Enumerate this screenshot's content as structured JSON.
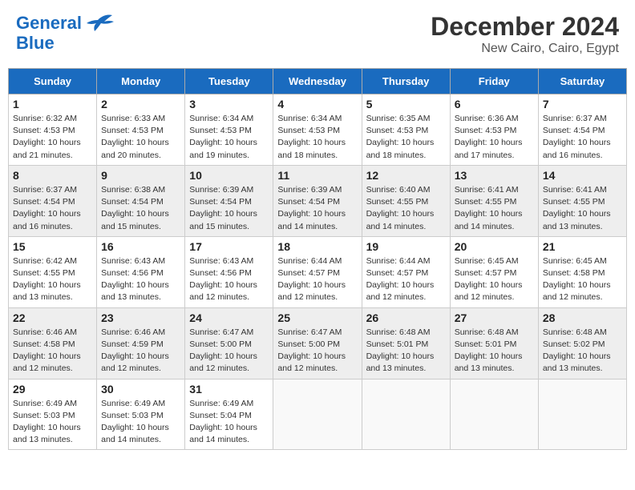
{
  "header": {
    "logo_line1": "General",
    "logo_line2": "Blue",
    "month": "December 2024",
    "location": "New Cairo, Cairo, Egypt"
  },
  "days_of_week": [
    "Sunday",
    "Monday",
    "Tuesday",
    "Wednesday",
    "Thursday",
    "Friday",
    "Saturday"
  ],
  "weeks": [
    [
      {
        "day": "1",
        "info": "Sunrise: 6:32 AM\nSunset: 4:53 PM\nDaylight: 10 hours\nand 21 minutes."
      },
      {
        "day": "2",
        "info": "Sunrise: 6:33 AM\nSunset: 4:53 PM\nDaylight: 10 hours\nand 20 minutes."
      },
      {
        "day": "3",
        "info": "Sunrise: 6:34 AM\nSunset: 4:53 PM\nDaylight: 10 hours\nand 19 minutes."
      },
      {
        "day": "4",
        "info": "Sunrise: 6:34 AM\nSunset: 4:53 PM\nDaylight: 10 hours\nand 18 minutes."
      },
      {
        "day": "5",
        "info": "Sunrise: 6:35 AM\nSunset: 4:53 PM\nDaylight: 10 hours\nand 18 minutes."
      },
      {
        "day": "6",
        "info": "Sunrise: 6:36 AM\nSunset: 4:53 PM\nDaylight: 10 hours\nand 17 minutes."
      },
      {
        "day": "7",
        "info": "Sunrise: 6:37 AM\nSunset: 4:54 PM\nDaylight: 10 hours\nand 16 minutes."
      }
    ],
    [
      {
        "day": "8",
        "info": "Sunrise: 6:37 AM\nSunset: 4:54 PM\nDaylight: 10 hours\nand 16 minutes."
      },
      {
        "day": "9",
        "info": "Sunrise: 6:38 AM\nSunset: 4:54 PM\nDaylight: 10 hours\nand 15 minutes."
      },
      {
        "day": "10",
        "info": "Sunrise: 6:39 AM\nSunset: 4:54 PM\nDaylight: 10 hours\nand 15 minutes."
      },
      {
        "day": "11",
        "info": "Sunrise: 6:39 AM\nSunset: 4:54 PM\nDaylight: 10 hours\nand 14 minutes."
      },
      {
        "day": "12",
        "info": "Sunrise: 6:40 AM\nSunset: 4:55 PM\nDaylight: 10 hours\nand 14 minutes."
      },
      {
        "day": "13",
        "info": "Sunrise: 6:41 AM\nSunset: 4:55 PM\nDaylight: 10 hours\nand 14 minutes."
      },
      {
        "day": "14",
        "info": "Sunrise: 6:41 AM\nSunset: 4:55 PM\nDaylight: 10 hours\nand 13 minutes."
      }
    ],
    [
      {
        "day": "15",
        "info": "Sunrise: 6:42 AM\nSunset: 4:55 PM\nDaylight: 10 hours\nand 13 minutes."
      },
      {
        "day": "16",
        "info": "Sunrise: 6:43 AM\nSunset: 4:56 PM\nDaylight: 10 hours\nand 13 minutes."
      },
      {
        "day": "17",
        "info": "Sunrise: 6:43 AM\nSunset: 4:56 PM\nDaylight: 10 hours\nand 12 minutes."
      },
      {
        "day": "18",
        "info": "Sunrise: 6:44 AM\nSunset: 4:57 PM\nDaylight: 10 hours\nand 12 minutes."
      },
      {
        "day": "19",
        "info": "Sunrise: 6:44 AM\nSunset: 4:57 PM\nDaylight: 10 hours\nand 12 minutes."
      },
      {
        "day": "20",
        "info": "Sunrise: 6:45 AM\nSunset: 4:57 PM\nDaylight: 10 hours\nand 12 minutes."
      },
      {
        "day": "21",
        "info": "Sunrise: 6:45 AM\nSunset: 4:58 PM\nDaylight: 10 hours\nand 12 minutes."
      }
    ],
    [
      {
        "day": "22",
        "info": "Sunrise: 6:46 AM\nSunset: 4:58 PM\nDaylight: 10 hours\nand 12 minutes."
      },
      {
        "day": "23",
        "info": "Sunrise: 6:46 AM\nSunset: 4:59 PM\nDaylight: 10 hours\nand 12 minutes."
      },
      {
        "day": "24",
        "info": "Sunrise: 6:47 AM\nSunset: 5:00 PM\nDaylight: 10 hours\nand 12 minutes."
      },
      {
        "day": "25",
        "info": "Sunrise: 6:47 AM\nSunset: 5:00 PM\nDaylight: 10 hours\nand 12 minutes."
      },
      {
        "day": "26",
        "info": "Sunrise: 6:48 AM\nSunset: 5:01 PM\nDaylight: 10 hours\nand 13 minutes."
      },
      {
        "day": "27",
        "info": "Sunrise: 6:48 AM\nSunset: 5:01 PM\nDaylight: 10 hours\nand 13 minutes."
      },
      {
        "day": "28",
        "info": "Sunrise: 6:48 AM\nSunset: 5:02 PM\nDaylight: 10 hours\nand 13 minutes."
      }
    ],
    [
      {
        "day": "29",
        "info": "Sunrise: 6:49 AM\nSunset: 5:03 PM\nDaylight: 10 hours\nand 13 minutes."
      },
      {
        "day": "30",
        "info": "Sunrise: 6:49 AM\nSunset: 5:03 PM\nDaylight: 10 hours\nand 14 minutes."
      },
      {
        "day": "31",
        "info": "Sunrise: 6:49 AM\nSunset: 5:04 PM\nDaylight: 10 hours\nand 14 minutes."
      },
      {
        "day": "",
        "info": ""
      },
      {
        "day": "",
        "info": ""
      },
      {
        "day": "",
        "info": ""
      },
      {
        "day": "",
        "info": ""
      }
    ]
  ]
}
